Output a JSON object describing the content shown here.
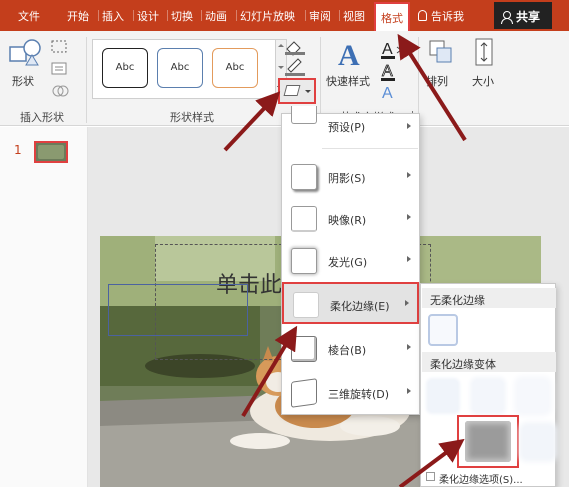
{
  "tabs": [
    "文件",
    "开始",
    "插入",
    "设计",
    "切换",
    "动画",
    "幻灯片放映",
    "审阅",
    "视图"
  ],
  "active_tab": "格式",
  "tell_me": "告诉我",
  "share": "共享",
  "ribbon": {
    "shape_label": "形状",
    "insert_shapes_group": "插入形状",
    "shape_styles_group": "形状样式",
    "style_samples": [
      "Abc",
      "Abc",
      "Abc"
    ],
    "quick_styles_label": "快速样式",
    "wordart_group": "艺术字样式",
    "arrange_label": "排列",
    "size_label": "大小"
  },
  "slide_panel": {
    "slide_number": "1"
  },
  "slide": {
    "title_text": "单击此处添加标题"
  },
  "effects_menu": {
    "items": [
      {
        "label": "预设(P)"
      },
      {
        "label": "阴影(S)"
      },
      {
        "label": "映像(R)"
      },
      {
        "label": "发光(G)"
      },
      {
        "label": "柔化边缘(E)"
      },
      {
        "label": "棱台(B)"
      },
      {
        "label": "三维旋转(D)"
      }
    ]
  },
  "soft_edges_submenu": {
    "no_soft_edges": "无柔化边缘",
    "variations": "柔化边缘变体",
    "options": "柔化边缘选项(S)..."
  },
  "colors": {
    "accent": "#c43e1c",
    "highlight": "#e04040",
    "arrow": "#8b1a1a"
  }
}
